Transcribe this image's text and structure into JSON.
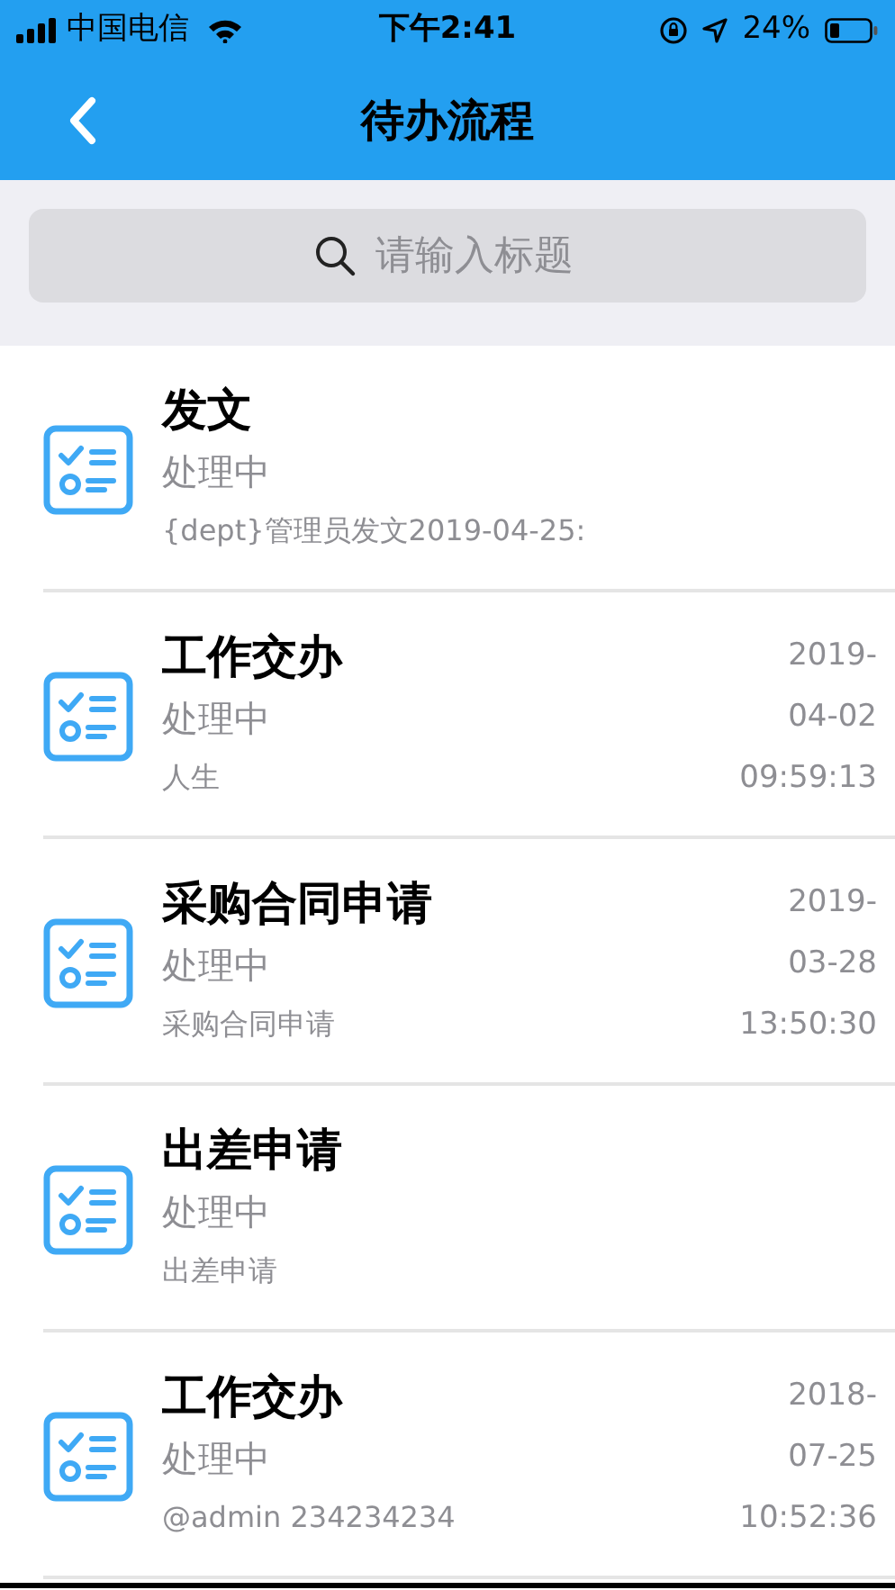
{
  "status_bar": {
    "carrier": "中国电信",
    "time": "下午2:41",
    "battery": "24%"
  },
  "nav": {
    "title": "待办流程"
  },
  "search": {
    "placeholder": "请输入标题"
  },
  "items": [
    {
      "title": "发文",
      "status": "处理中",
      "detail": "{dept}管理员发文2019-04-25:"
    },
    {
      "title": "工作交办",
      "status": "处理中",
      "detail": "人生",
      "date_lines": [
        "2019-",
        "04-02",
        "09:59:13"
      ]
    },
    {
      "title": "采购合同申请",
      "status": "处理中",
      "detail": "采购合同申请",
      "date_lines": [
        "2019-",
        "03-28",
        "13:50:30"
      ]
    },
    {
      "title": "出差申请",
      "status": "处理中",
      "detail": "出差申请"
    },
    {
      "title": "工作交办",
      "status": "处理中",
      "detail": "@admin 234234234",
      "date_lines": [
        "2018-",
        "07-25",
        "10:52:36"
      ]
    }
  ]
}
